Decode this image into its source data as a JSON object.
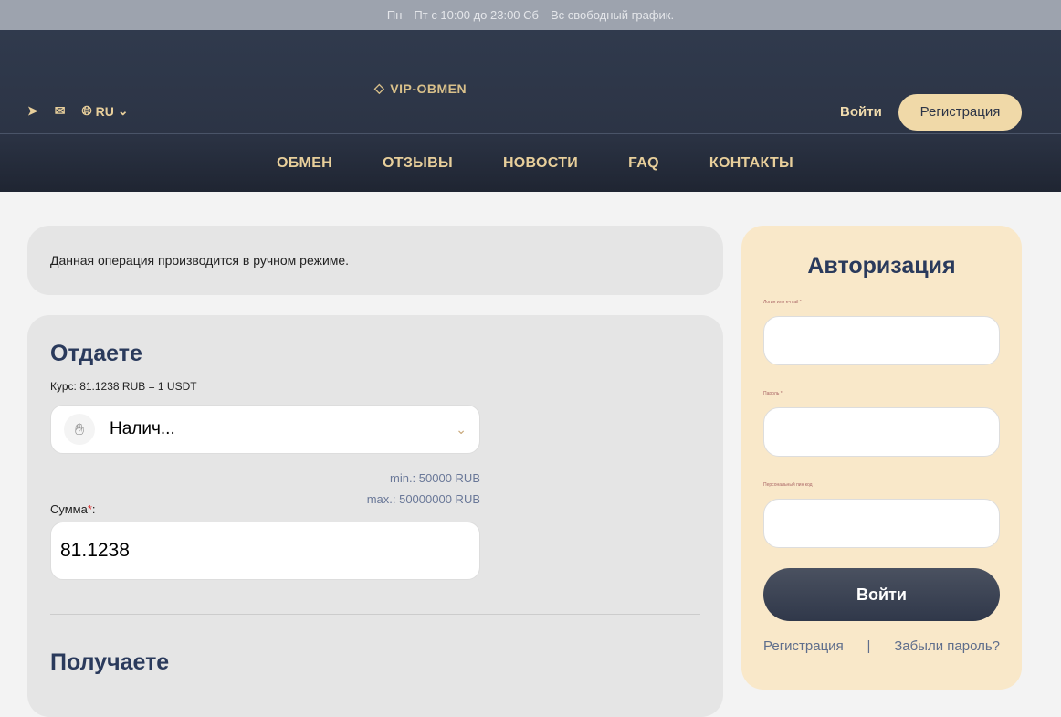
{
  "topbar": {
    "schedule": "Пн—Пт с 10:00 до 23:00 Сб—Вс свободный график."
  },
  "header": {
    "lang": "RU",
    "logo": "VIP-OBMEN",
    "login": "Войти",
    "register": "Регистрация"
  },
  "nav": [
    "ОБМЕН",
    "ОТЗЫВЫ",
    "НОВОСТИ",
    "FAQ",
    "КОНТАКТЫ"
  ],
  "notice": "Данная операция производится в ручном режиме.",
  "give": {
    "title": "Отдаете",
    "rate": "Курс: 81.1238 RUB = 1 USDT",
    "currency": "Налич...",
    "min": "min.: 50000 RUB",
    "max": "max.: 50000000 RUB",
    "sum_label": "Сумма",
    "required": "*",
    "sum_value": "81.1238"
  },
  "receive": {
    "title": "Получаете"
  },
  "auth": {
    "title": "Авторизация",
    "login_label": "Логин или e-mail *",
    "password_label": "Пароль *",
    "pin_label": "Персональный пин код",
    "submit": "Войти",
    "register": "Регистрация",
    "separator": "|",
    "forgot": "Забыли пароль?"
  }
}
